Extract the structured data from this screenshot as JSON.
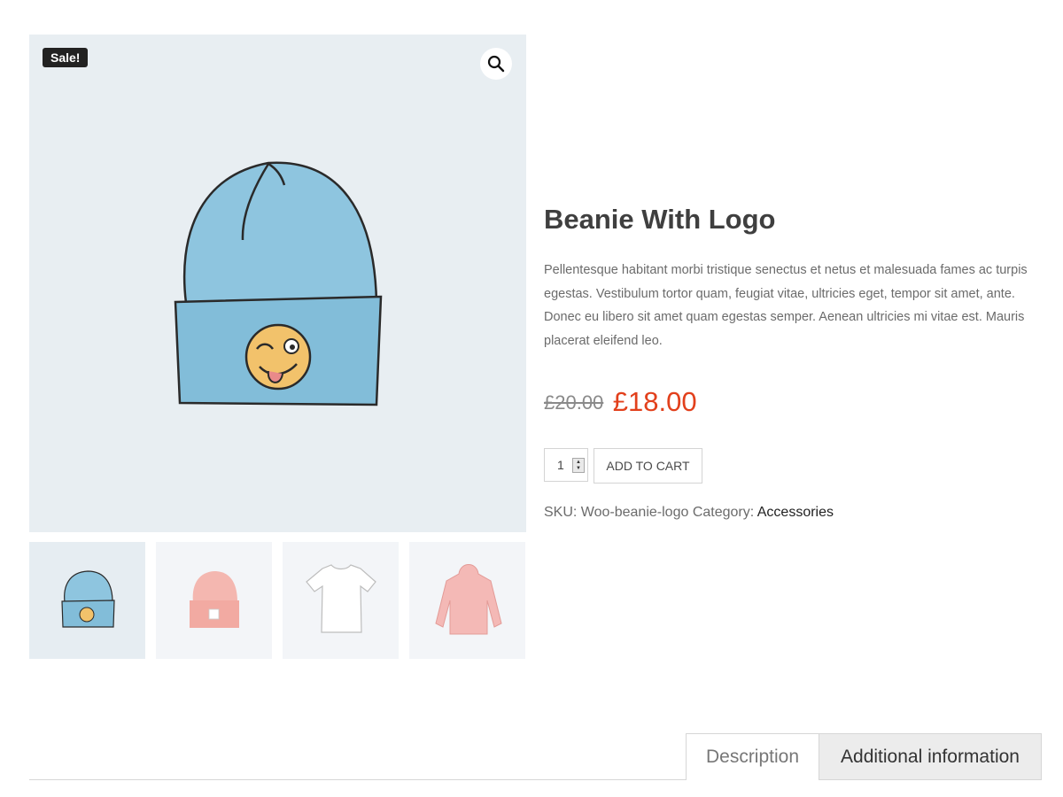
{
  "gallery": {
    "sale_badge": "Sale!",
    "zoom_icon": "magnifier-icon",
    "main_image": "blue-beanie-with-logo",
    "colors": {
      "background": "#e8eef2",
      "beanie": "#8ec5df",
      "face": "#f2c26b",
      "tongue": "#e98a8a"
    },
    "thumbnails": [
      {
        "name": "blue-beanie-with-logo",
        "active": true
      },
      {
        "name": "pink-beanie"
      },
      {
        "name": "white-t-shirt"
      },
      {
        "name": "pink-hoodie"
      }
    ]
  },
  "product": {
    "title": "Beanie With Logo",
    "description": "Pellentesque habitant morbi tristique senectus et netus et malesuada fames ac turpis egestas. Vestibulum tortor quam, feugiat vitae, ultricies eget, tempor sit amet, ante. Donec eu libero sit amet quam egestas semper. Aenean ultricies mi vitae est. Mauris placerat eleifend leo.",
    "regular_price": "£20.00",
    "sale_price": "£18.00",
    "sale_color": "#e2401c",
    "quantity": "1",
    "add_to_cart_label": "ADD TO CART",
    "sku_label": "SKU:",
    "sku": "Woo-beanie-logo",
    "category_label": "Category:",
    "category": "Accessories"
  },
  "tabs": [
    {
      "label": "Description",
      "active": true
    },
    {
      "label": "Additional information",
      "active": false
    }
  ]
}
